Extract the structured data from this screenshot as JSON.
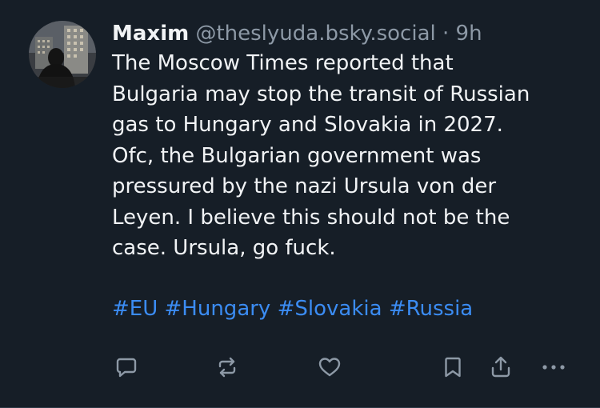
{
  "post": {
    "author_name": "Maxim",
    "author_handle": "@theslyuda.bsky.social",
    "separator": "·",
    "time": "9h",
    "body_lines": [
      "The Moscow Times reported that",
      "Bulgaria may stop the transit of Russian",
      "gas to Hungary and Slovakia in 2027.",
      "Ofc, the Bulgarian government was",
      "pressured by the nazi Ursula von der",
      "Leyen. I believe this should not be the",
      "case. Ursula, go fuck."
    ],
    "hashtags": [
      "#EU",
      "#Hungary",
      "#Slovakia",
      "#Russia"
    ]
  },
  "actions": [
    "reply-icon",
    "repost-icon",
    "like-icon",
    "bookmark-icon",
    "share-icon",
    "more-icon"
  ],
  "colors": {
    "background": "#161e27",
    "text": "#f1f3f5",
    "muted": "#8d99a6",
    "link": "#3b8cf3",
    "icon": "#8d99a6"
  }
}
